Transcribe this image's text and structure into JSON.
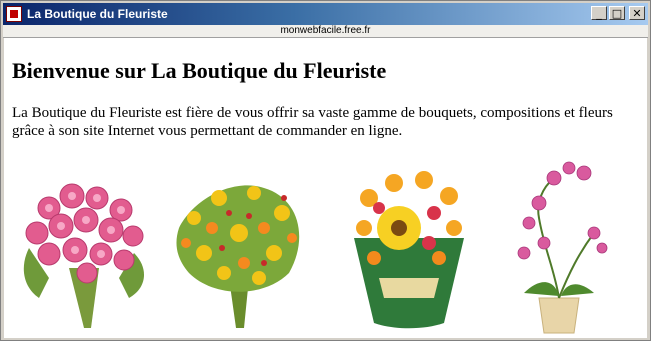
{
  "window": {
    "title": "La Boutique du Fleuriste",
    "url": "monwebfacile.free.fr",
    "controls": {
      "minimize": "_",
      "maximize": "□",
      "close": "✕"
    }
  },
  "page": {
    "heading": "Bienvenue sur La Boutique du Fleuriste",
    "intro": "La Boutique du Fleuriste est fière de vous offrir sa vaste gamme de bouquets, compositions et fleurs grâce à son site Internet vous permettant de commander en ligne."
  },
  "gallery": [
    {
      "name": "pink-rose-bouquet-image"
    },
    {
      "name": "yellow-wildflower-bouquet-image"
    },
    {
      "name": "sunflower-arrangement-image"
    },
    {
      "name": "pink-orchid-plant-image"
    }
  ],
  "colors": {
    "titlebar_start": "#0a246a",
    "titlebar_end": "#a6caf0",
    "page_bg": "#ffffff"
  }
}
